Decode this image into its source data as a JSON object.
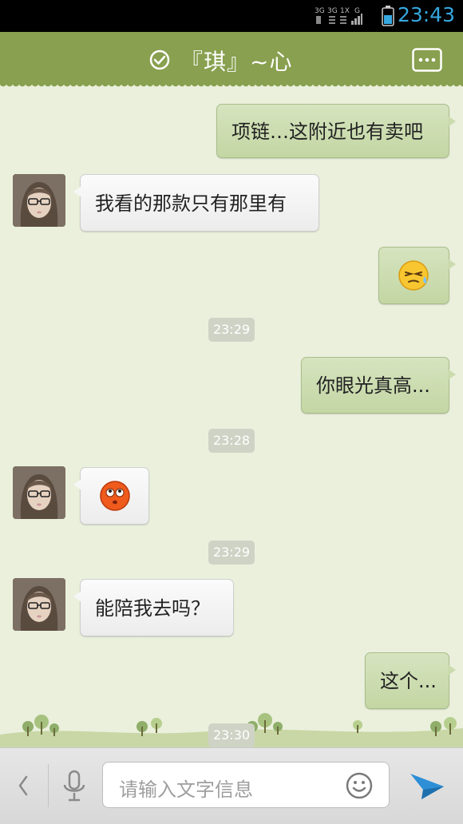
{
  "status": {
    "clock": "23:43",
    "net_top": "3G 3G 1X G"
  },
  "header": {
    "title": "『琪』~心"
  },
  "messages": [
    {
      "side": "out",
      "text": "项链…这附近也有卖吧"
    },
    {
      "side": "in",
      "text": "我看的那款只有那里有"
    },
    {
      "side": "out",
      "emoji": "sweat-face-emoji"
    },
    {
      "timestamp": "23:29"
    },
    {
      "side": "out",
      "text": "你眼光真高..."
    },
    {
      "timestamp": "23:28"
    },
    {
      "side": "in",
      "emoji": "rolling-eyes-face-emoji"
    },
    {
      "timestamp": "23:29"
    },
    {
      "side": "in",
      "text": "能陪我去吗？"
    },
    {
      "side": "out",
      "text": "这个..."
    },
    {
      "timestamp": "23:30"
    }
  ],
  "input": {
    "placeholder": "请输入文字信息"
  },
  "colors": {
    "accent": "#88a04f",
    "clock": "#36a8e0",
    "send": "#2e8fd6"
  }
}
